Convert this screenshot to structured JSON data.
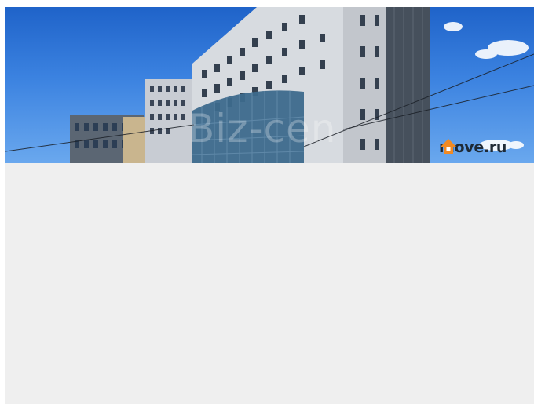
{
  "photo": {
    "subject": "office-building-photo",
    "watermark_text": "Biz-cen",
    "brand_text": "move.ru",
    "brand_color": "#f08a24",
    "sky_color": "#2f76d6"
  },
  "page": {
    "background": "#efefef"
  }
}
